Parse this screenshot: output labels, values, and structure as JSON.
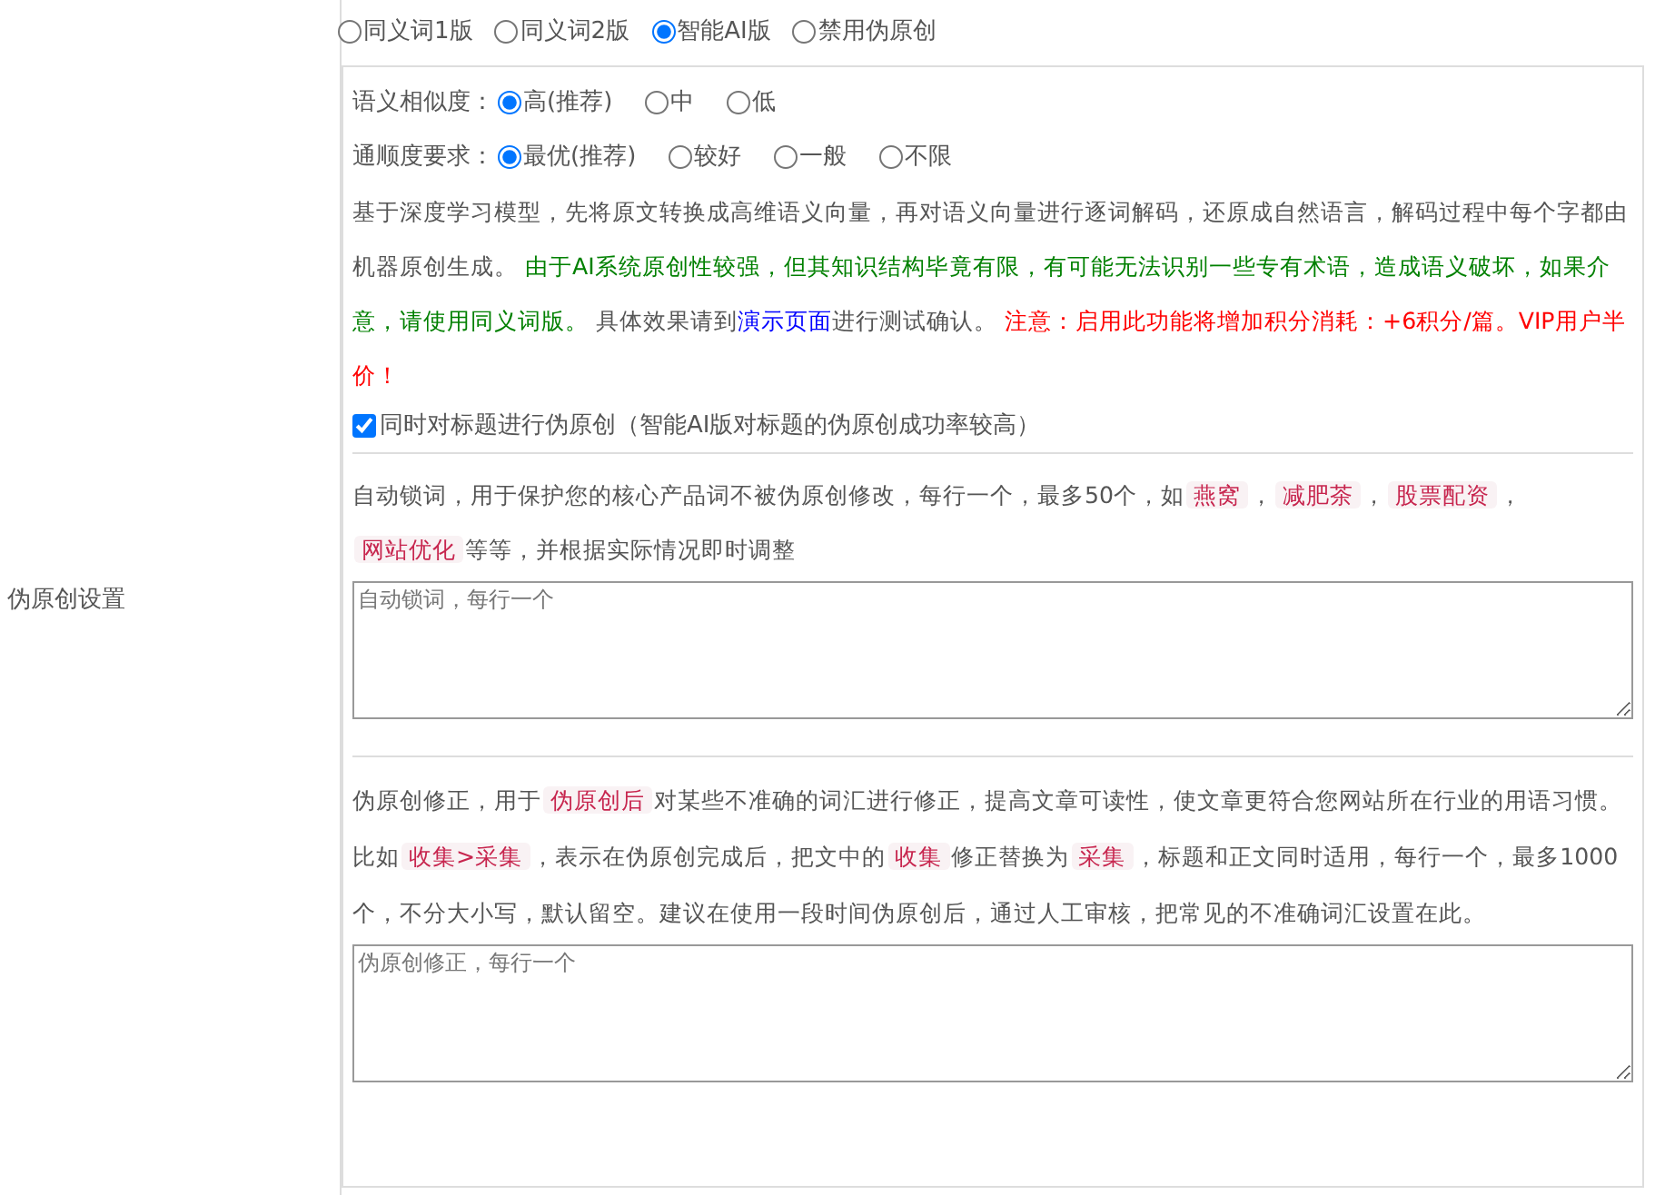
{
  "section_label": "伪原创设置",
  "modes": [
    {
      "label": "同义词1版",
      "selected": false
    },
    {
      "label": "同义词2版",
      "selected": false
    },
    {
      "label": "智能AI版",
      "selected": true
    },
    {
      "label": "禁用伪原创",
      "selected": false
    }
  ],
  "option_groups": [
    {
      "label": "语义相似度：",
      "options": [
        {
          "label": "高(推荐)",
          "selected": true
        },
        {
          "label": "中",
          "selected": false
        },
        {
          "label": "低",
          "selected": false
        }
      ]
    },
    {
      "label": "通顺度要求：",
      "options": [
        {
          "label": "最优(推荐)",
          "selected": true
        },
        {
          "label": "较好",
          "selected": false
        },
        {
          "label": "一般",
          "selected": false
        },
        {
          "label": "不限",
          "selected": false
        }
      ]
    }
  ],
  "description": [
    {
      "kind": "plain",
      "text": "基于深度学习模型，先将原文转换成高维语义向量，再对语义向量进行逐词解码，还原成自然语言，解码过程中每个字都由机器原创生成。 "
    },
    {
      "kind": "notice",
      "text": "由于AI系统原创性较强，但其知识结构毕竟有限，有可能无法识别一些专有术语，造成语义破坏，如果介意，请使用同义词版。"
    },
    {
      "kind": "plain",
      "text": " 具体效果请到"
    },
    {
      "kind": "link",
      "text": "演示页面"
    },
    {
      "kind": "plain",
      "text": "进行测试确认。 "
    },
    {
      "kind": "warning",
      "text": "注意：启用此功能将增加积分消耗：+6积分/篇。VIP用户半价！"
    }
  ],
  "title_option": {
    "label": "同时对标题进行伪原创（智能AI版对标题的伪原创成功率较高）",
    "checked": true
  },
  "lock_words": {
    "help": [
      {
        "kind": "plain",
        "text": "自动锁词，用于保护您的核心产品词不被伪原创修改，每行一个，最多50个，如"
      },
      {
        "kind": "code",
        "text": "燕窝"
      },
      {
        "kind": "plain",
        "text": "，"
      },
      {
        "kind": "code",
        "text": "减肥茶"
      },
      {
        "kind": "plain",
        "text": "，"
      },
      {
        "kind": "code",
        "text": "股票配资"
      },
      {
        "kind": "plain",
        "text": "，"
      },
      {
        "kind": "code",
        "text": "网站优化"
      },
      {
        "kind": "plain",
        "text": "等等，并根据实际情况即时调整"
      }
    ],
    "placeholder": "自动锁词，每行一个"
  },
  "corrections": {
    "help": [
      {
        "kind": "plain",
        "text": "伪原创修正，用于"
      },
      {
        "kind": "code",
        "text": "伪原创后"
      },
      {
        "kind": "plain",
        "text": "对某些不准确的词汇进行修正，提高文章可读性，使文章更符合您网站所在行业的用语习惯。比如"
      },
      {
        "kind": "code",
        "text": "收集>采集"
      },
      {
        "kind": "plain",
        "text": "，表示在伪原创完成后，把文中的"
      },
      {
        "kind": "code",
        "text": "收集"
      },
      {
        "kind": "plain",
        "text": "修正替换为"
      },
      {
        "kind": "code",
        "text": "采集"
      },
      {
        "kind": "plain",
        "text": "，标题和正文同时适用，每行一个，最多1000个，不分大小写，默认留空。建议在使用一段时间伪原创后，通过人工审核，把常见的不准确词汇设置在此。"
      }
    ],
    "placeholder": "伪原创修正，每行一个"
  }
}
